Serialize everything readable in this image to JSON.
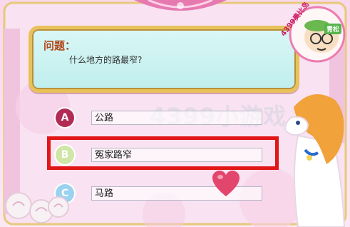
{
  "question": {
    "label": "问题：",
    "text": "什么地方的路最窄?"
  },
  "watermark": "4399小游戏",
  "choices": [
    {
      "letter": "A",
      "answer": "公路",
      "selected": false
    },
    {
      "letter": "B",
      "answer": "冤家路窄",
      "selected": true
    },
    {
      "letter": "C",
      "answer": "马路",
      "selected": false
    }
  ],
  "badge": {
    "text": "4399奥比岛",
    "tag": "青松"
  },
  "colors": {
    "highlight": "#e11717",
    "choice_a": "#b22b55",
    "choice_b": "#cfe6a6",
    "choice_c": "#9ad2ef",
    "question_bg": "#c8f1f0",
    "question_label": "#b2461a"
  },
  "icons": {
    "mascot": "cartoon-kid-face",
    "heart": "heart-icon",
    "pony": "orange-maned-pony",
    "roses": "rose-bouquet"
  }
}
